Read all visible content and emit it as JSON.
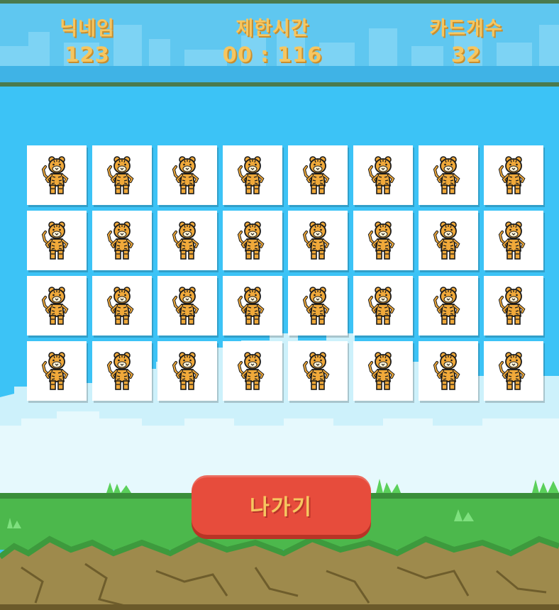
{
  "header": {
    "nickname": {
      "label": "닉네임",
      "value": "123"
    },
    "time_limit": {
      "label": "제한시간",
      "value": "00 : 116"
    },
    "card_count": {
      "label": "카드개수",
      "value": "32"
    }
  },
  "board": {
    "rows": 4,
    "columns": 8,
    "cards": [
      {
        "icon": "tiger-icon",
        "face": "down"
      },
      {
        "icon": "tiger-icon",
        "face": "down"
      },
      {
        "icon": "tiger-icon",
        "face": "down"
      },
      {
        "icon": "tiger-icon",
        "face": "down"
      },
      {
        "icon": "tiger-icon",
        "face": "down"
      },
      {
        "icon": "tiger-icon",
        "face": "down"
      },
      {
        "icon": "tiger-icon",
        "face": "down"
      },
      {
        "icon": "tiger-icon",
        "face": "down"
      },
      {
        "icon": "tiger-icon",
        "face": "down"
      },
      {
        "icon": "tiger-icon",
        "face": "down"
      },
      {
        "icon": "tiger-icon",
        "face": "down"
      },
      {
        "icon": "tiger-icon",
        "face": "down"
      },
      {
        "icon": "tiger-icon",
        "face": "down"
      },
      {
        "icon": "tiger-icon",
        "face": "down"
      },
      {
        "icon": "tiger-icon",
        "face": "down"
      },
      {
        "icon": "tiger-icon",
        "face": "down"
      },
      {
        "icon": "tiger-icon",
        "face": "down"
      },
      {
        "icon": "tiger-icon",
        "face": "down"
      },
      {
        "icon": "tiger-icon",
        "face": "down"
      },
      {
        "icon": "tiger-icon",
        "face": "down"
      },
      {
        "icon": "tiger-icon",
        "face": "down"
      },
      {
        "icon": "tiger-icon",
        "face": "down"
      },
      {
        "icon": "tiger-icon",
        "face": "down"
      },
      {
        "icon": "tiger-icon",
        "face": "down"
      },
      {
        "icon": "tiger-icon",
        "face": "down"
      },
      {
        "icon": "tiger-icon",
        "face": "down"
      },
      {
        "icon": "tiger-icon",
        "face": "down"
      },
      {
        "icon": "tiger-icon",
        "face": "down"
      },
      {
        "icon": "tiger-icon",
        "face": "down"
      },
      {
        "icon": "tiger-icon",
        "face": "down"
      },
      {
        "icon": "tiger-icon",
        "face": "down"
      },
      {
        "icon": "tiger-icon",
        "face": "down"
      }
    ]
  },
  "exit_button": {
    "label": "나가기"
  },
  "colors": {
    "sky": "#3cc3f6",
    "header": "#5fc7f0",
    "header_border": "#4a7a4e",
    "text_gold": "#f6c660",
    "button_red": "#e74c3c",
    "grass": "#4cb84c",
    "dirt": "#9e8a4c"
  }
}
